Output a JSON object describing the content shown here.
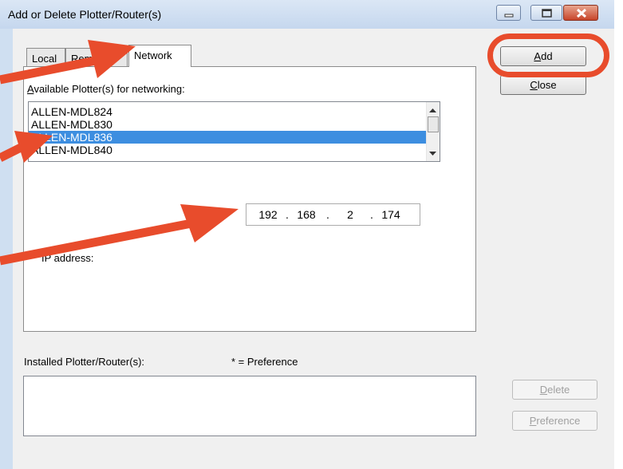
{
  "window": {
    "title": "Add or Delete Plotter/Router(s)",
    "caption_buttons": [
      "minimize-icon",
      "maximize-icon",
      "close-icon"
    ]
  },
  "tabs": [
    {
      "label": "Local",
      "active": false
    },
    {
      "label": "Remote",
      "active": false
    },
    {
      "label": "Network",
      "active": true
    }
  ],
  "available_label": {
    "mnemonic": "A",
    "rest": "vailable Plotter(s) for networking:"
  },
  "plotters": {
    "items": [
      "ALLEN-MDL824",
      "ALLEN-MDL830",
      "ALLEN-MDL836",
      "ALLEN-MDL840"
    ],
    "selected_index": 2
  },
  "ip": {
    "label": "IP address:",
    "octets": [
      "192",
      "168",
      "2",
      "174"
    ],
    "separator": "."
  },
  "installed": {
    "label": "Installed Plotter/Router(s):",
    "preference_note": "* = Preference",
    "items": []
  },
  "buttons": {
    "add": {
      "mnemonic": "A",
      "rest": "dd"
    },
    "close": {
      "mnemonic": "C",
      "rest": "lose"
    },
    "delete": {
      "mnemonic": "D",
      "rest": "elete"
    },
    "preference": {
      "mnemonic": "P",
      "rest": "reference"
    }
  },
  "annotation_color": "#e84c2c"
}
